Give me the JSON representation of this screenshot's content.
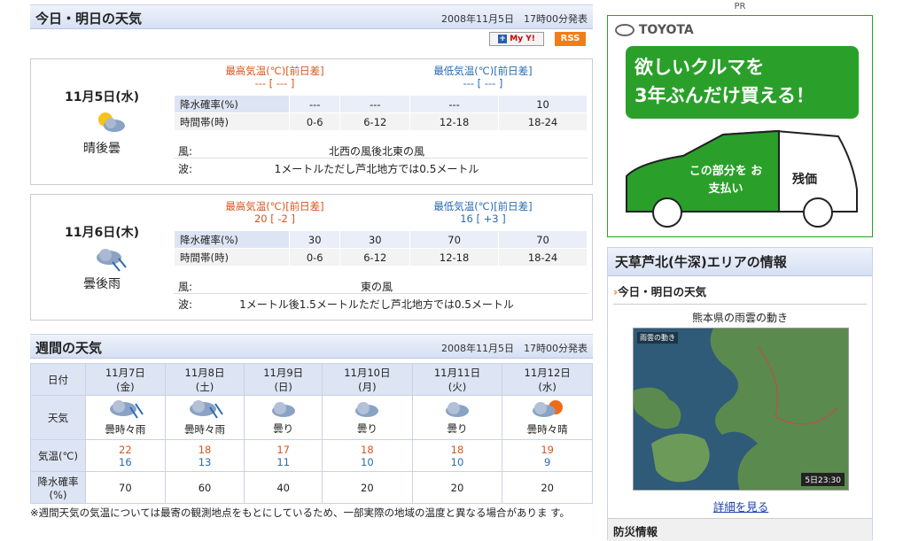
{
  "today_section": {
    "title": "今日・明日の天気",
    "issued": "2008年11月5日　17時00分発表",
    "myyahoo": "My Y!",
    "rss": "RSS"
  },
  "day1": {
    "date": "11月5日(水)",
    "weather": "晴後曇",
    "max_label": "最高気温(℃)[前日差]",
    "max_value": "--- [ --- ]",
    "min_label": "最低気温(℃)[前日差]",
    "min_value": "--- [ --- ]",
    "precip_label": "降水確率(%)",
    "time_label": "時間帯(時)",
    "precip": [
      "---",
      "---",
      "---",
      "10"
    ],
    "times": [
      "0-6",
      "6-12",
      "12-18",
      "18-24"
    ],
    "wind_label": "風:",
    "wind": "北西の風後北東の風",
    "wave_label": "波:",
    "wave": "1メートルただし芦北地方では0.5メートル"
  },
  "day2": {
    "date": "11月6日(木)",
    "weather": "曇後雨",
    "max_label": "最高気温(℃)[前日差]",
    "max_value": "20 [ -2 ]",
    "min_label": "最低気温(℃)[前日差]",
    "min_value": "16 [ +3 ]",
    "precip_label": "降水確率(%)",
    "time_label": "時間帯(時)",
    "precip": [
      "30",
      "30",
      "70",
      "70"
    ],
    "times": [
      "0-6",
      "6-12",
      "12-18",
      "18-24"
    ],
    "wind_label": "風:",
    "wind": "東の風",
    "wave_label": "波:",
    "wave": "1メートル後1.5メートルただし芦北地方では0.5メートル"
  },
  "week": {
    "title": "週間の天気",
    "issued": "2008年11月5日　17時00分発表",
    "row_date": "日付",
    "row_weather": "天気",
    "row_temp": "気温(℃)",
    "row_precip": "降水確率(%)",
    "days": [
      {
        "date": "11月7日",
        "dow": "(金)",
        "weather": "曇時々雨",
        "high": "22",
        "low": "16",
        "precip": "70",
        "icon": "cloud-rain-icon"
      },
      {
        "date": "11月8日",
        "dow": "(土)",
        "weather": "曇時々雨",
        "high": "18",
        "low": "13",
        "precip": "60",
        "icon": "cloud-rain-icon"
      },
      {
        "date": "11月9日",
        "dow": "(日)",
        "weather": "曇り",
        "high": "17",
        "low": "11",
        "precip": "40",
        "icon": "cloud-icon"
      },
      {
        "date": "11月10日",
        "dow": "(月)",
        "weather": "曇り",
        "high": "18",
        "low": "10",
        "precip": "20",
        "icon": "cloud-icon"
      },
      {
        "date": "11月11日",
        "dow": "(火)",
        "weather": "曇り",
        "high": "18",
        "low": "10",
        "precip": "20",
        "icon": "cloud-icon"
      },
      {
        "date": "11月12日",
        "dow": "(水)",
        "weather": "曇時々晴",
        "high": "19",
        "low": "9",
        "precip": "20",
        "icon": "cloud-sun-icon"
      }
    ],
    "note": "※週間天気の気温については最寄の観測地点をもとにしているため、一部実際の地域の温度と異なる場合がありま す。"
  },
  "ad": {
    "pr": "PR",
    "brand": "TOYOTA",
    "headline1": "欲しいクルマを",
    "headline2": "3年ぶんだけ買える！",
    "pay": "この部分を お支払い",
    "residual": "残価"
  },
  "area": {
    "title": "天草芦北(牛深)エリアの情報",
    "link": "今日・明日の天気",
    "map_title": "熊本県の雨雲の動き",
    "map_label": "雨雲の動き",
    "map_time": "5日23:30",
    "detail": "詳細を見る",
    "disaster": "防災情報"
  },
  "colors": {
    "accent_green": "#2aa02a",
    "header_blue": "#d6e0f3",
    "temp_red": "#d9541e",
    "temp_blue": "#2a6bb0"
  }
}
